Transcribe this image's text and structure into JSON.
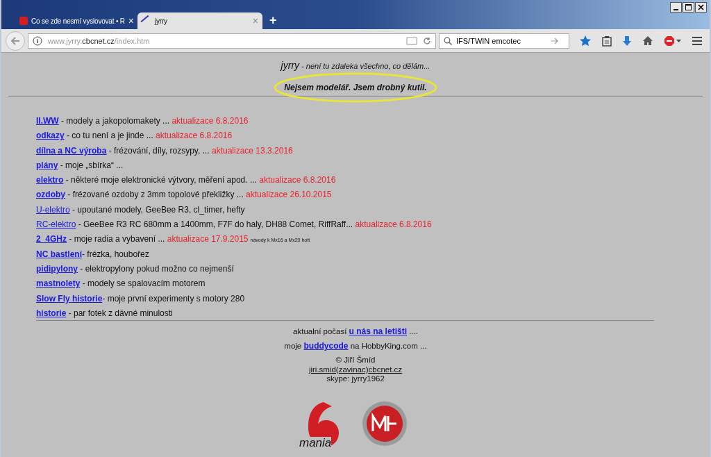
{
  "tabs": [
    {
      "title": "Co se zde nesmí vyslovovat • R",
      "selected": false,
      "close": "×"
    },
    {
      "title": "jyrry",
      "selected": true,
      "close": "×"
    }
  ],
  "new_tab": "+",
  "address": {
    "prefix": "www.jyrry.",
    "domain": "cbcnet.cz",
    "path": "/index.htm"
  },
  "search": {
    "value": "IFS/TWIN emcotec"
  },
  "page": {
    "site_name": "jyrry",
    "tagline": " - není tu zdaleka všechno, co dělám...",
    "motto": "Nejsem modelář. Jsem drobný kutil.",
    "links": [
      {
        "label": "II.WW",
        "bold": true,
        "description": " - modely a jakopolomakety ... ",
        "update": "aktualizace 6.8.2016"
      },
      {
        "label": "odkazy",
        "bold": true,
        "description": " - co tu není a je jinde ... ",
        "update": "aktualizace 6.8.2016"
      },
      {
        "label": "dílna a NC výroba",
        "bold": true,
        "description": " - frézování, díly, rozsypy, ... ",
        "update": "aktualizace 13.3.2016"
      },
      {
        "label": "plány",
        "bold": true,
        "description": " - moje „sbírka“ ..."
      },
      {
        "label": "elektro",
        "bold": true,
        "description": " - některé moje elektronické výtvory, měření apod. ... ",
        "update": "aktualizace 6.8.2016"
      },
      {
        "label": "ozdoby",
        "bold": true,
        "description": " - frézované ozdoby z 3mm topolové překližky ... ",
        "update": "aktualizace 26.10.2015"
      },
      {
        "label": "U-elektro",
        "bold": false,
        "description": " - upoutané modely, GeeBee R3, cl_timer, hefty"
      },
      {
        "label": "RC-elektro",
        "bold": false,
        "description": " - GeeBee R3 RC 680mm a 1400mm, F7F do haly, DH88 Comet, RiffRaff... ",
        "update": "aktualizace 6.8.2016"
      },
      {
        "label": "2_4GHz",
        "bold": true,
        "description": " - moje radia a vybavení ... ",
        "update": "aktualizace 17.9.2015",
        "note": "návody k Mx16 a Mx20 hott"
      },
      {
        "label": "NC bastlení",
        "bold": true,
        "description": "- frézka, houbořez"
      },
      {
        "label": "pidipylony",
        "bold": true,
        "description": " - elektropylony pokud možno co nejmenší"
      },
      {
        "label": "mastnolety",
        "bold": true,
        "description": " - modely se spalovacím motorem"
      },
      {
        "label": "Slow Fly historie",
        "bold": true,
        "description": "- moje první experimenty s motory 280"
      },
      {
        "label": "historie",
        "bold": true,
        "description": " - par fotek z dávné minulosti"
      }
    ],
    "weather": {
      "before": "aktualní počasí ",
      "link": "u nás na letišti",
      "after": " ...."
    },
    "buddy": {
      "before": "moje ",
      "link": "buddycode",
      "after": " na HobbyKing.com ..."
    },
    "copyright": "© Jiří Šmíd",
    "email": "jiri.smid(zavinac)cbcnet.cz",
    "skype": "skype: jyrry1962",
    "logo_text": "mania"
  }
}
